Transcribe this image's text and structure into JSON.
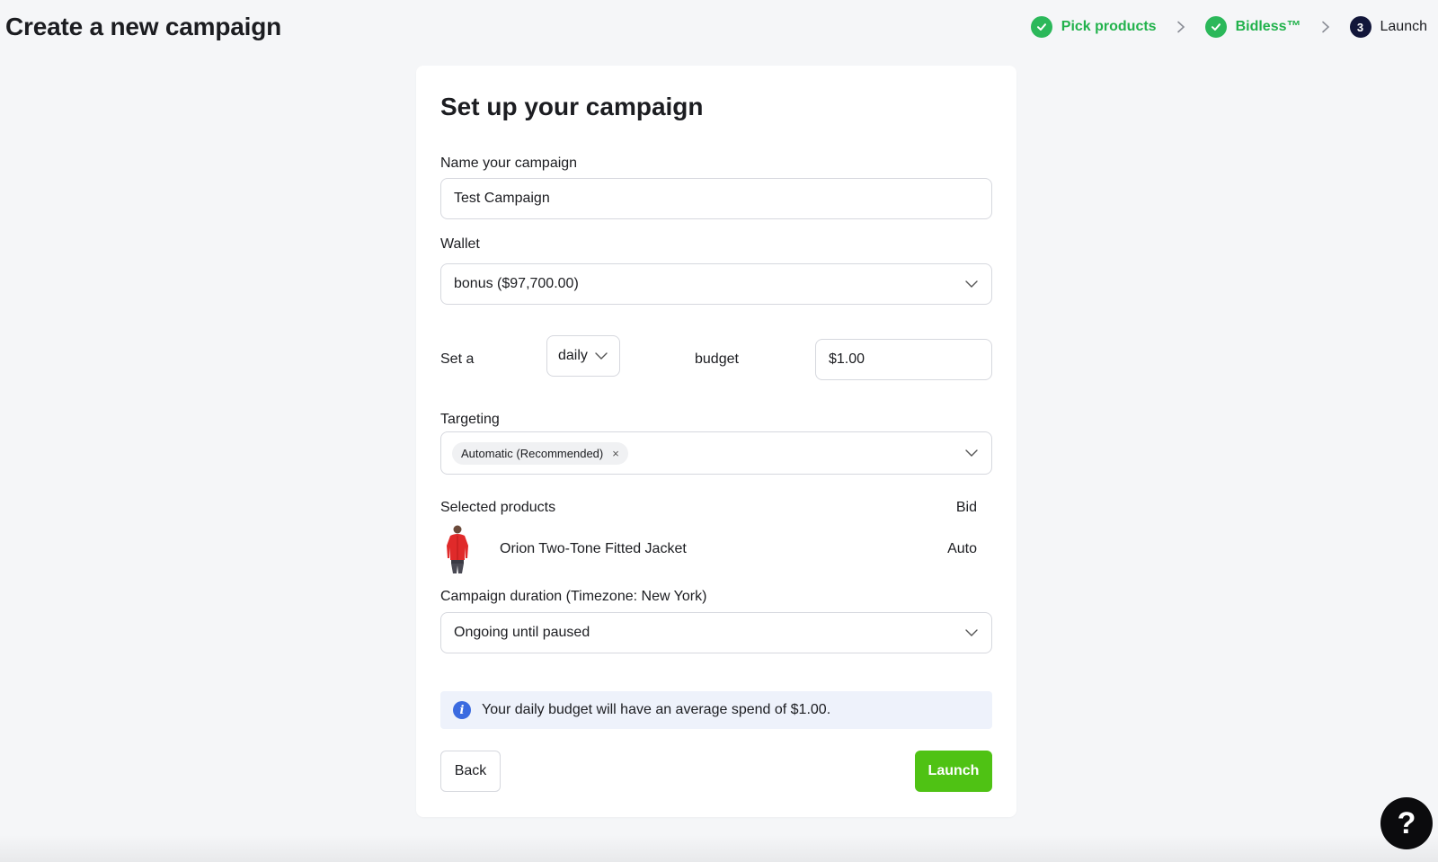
{
  "page": {
    "title": "Create a new campaign"
  },
  "stepper": {
    "steps": [
      {
        "label": "Pick products",
        "state": "done"
      },
      {
        "label": "Bidless™",
        "state": "done"
      },
      {
        "label": "Launch",
        "state": "current",
        "number": "3"
      }
    ]
  },
  "form": {
    "title": "Set up your campaign",
    "name_label": "Name your campaign",
    "name_value": "Test Campaign",
    "wallet_label": "Wallet",
    "wallet_value": "bonus ($97,700.00)",
    "budget_prefix": "Set a",
    "budget_period": "daily",
    "budget_suffix": "budget",
    "budget_value": "$1.00",
    "targeting_label": "Targeting",
    "targeting_tag": "Automatic (Recommended)",
    "targeting_tag_remove": "×",
    "products_label": "Selected products",
    "bid_label": "Bid",
    "products": [
      {
        "name": "Orion Two-Tone Fitted Jacket",
        "bid": "Auto"
      }
    ],
    "duration_label": "Campaign duration (Timezone: New York)",
    "duration_value": "Ongoing until paused",
    "info_text": "Your daily budget will have an average spend of $1.00.",
    "info_icon": "i",
    "back_label": "Back",
    "launch_label": "Launch"
  },
  "help": {
    "label": "?"
  },
  "colors": {
    "accent_green": "#4fc214",
    "step_done": "#22b24c",
    "step_current": "#12163a",
    "info_bg": "#eef2fb",
    "info_icon": "#3b6be0"
  }
}
